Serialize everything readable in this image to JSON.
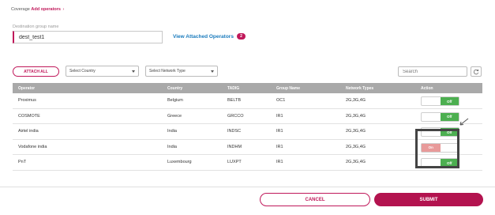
{
  "breadcrumb": {
    "root": "Coverage",
    "current": "Add operators",
    "sep": "›"
  },
  "destination": {
    "label": "Destination group name",
    "value": "dest_test1"
  },
  "view_attached": {
    "label": "View Attached Operators",
    "count": "2"
  },
  "toolbar": {
    "attach_all": "ATTACH ALL",
    "country_select": "Select Country",
    "network_select": "Select Network Type",
    "search_placeholder": "Search"
  },
  "table": {
    "headers": {
      "operator": "Operator",
      "country": "Country",
      "tadig": "TADIG",
      "group": "Group Name",
      "network": "Network Types",
      "action": "Action"
    },
    "rows": [
      {
        "operator": "Proximus",
        "country": "Belgium",
        "tadig": "BELTB",
        "group": "OC1",
        "network": "2G,3G,4G",
        "toggle": "Off",
        "state": "off"
      },
      {
        "operator": "COSMOTE",
        "country": "Greece",
        "tadig": "GRCCO",
        "group": "IR1",
        "network": "2G,3G,4G",
        "toggle": "Off",
        "state": "off"
      },
      {
        "operator": "Airtel india",
        "country": "India",
        "tadig": "INDSC",
        "group": "IR1",
        "network": "2G,3G,4G",
        "toggle": "Off",
        "state": "off"
      },
      {
        "operator": "Vodafone india",
        "country": "India",
        "tadig": "INDHM",
        "group": "IR1",
        "network": "2G,3G,4G",
        "toggle": "On",
        "state": "on"
      },
      {
        "operator": "PnT",
        "country": "Luxembourg",
        "tadig": "LUXPT",
        "group": "IR1",
        "network": "2G,3G,4G",
        "toggle": "Off",
        "state": "off"
      }
    ]
  },
  "footer": {
    "cancel": "CANCEL",
    "submit": "SUBMIT"
  },
  "colors": {
    "accent": "#c0185a",
    "link": "#1a7bbd",
    "toggle_off": "#4caf50",
    "toggle_on": "#e89a9a",
    "header_bg": "#a9a9a9"
  },
  "icons": {
    "refresh": "refresh-icon",
    "dropdown": "chevron-down-icon",
    "annotation": "arrow-icon"
  }
}
